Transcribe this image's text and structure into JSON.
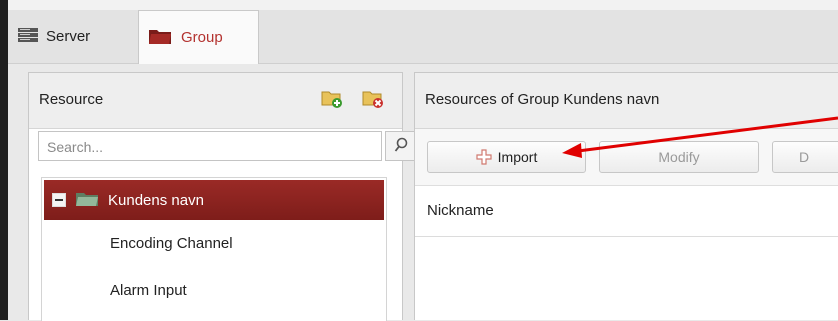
{
  "tabs": [
    {
      "label": "Server",
      "icon": "server-icon",
      "active": false
    },
    {
      "label": "Group",
      "icon": "group-folder-icon",
      "active": true
    }
  ],
  "resource_panel": {
    "title": "Resource",
    "icons": [
      "add-group-icon",
      "delete-group-icon"
    ],
    "search_placeholder": "Search...",
    "tree": {
      "root_label": "Kundens navn",
      "children": [
        "Encoding Channel",
        "Alarm Input"
      ]
    }
  },
  "group_panel": {
    "title": "Resources of Group Kundens navn",
    "buttons": {
      "import": "Import",
      "modify": "Modify",
      "delete": "D"
    },
    "columns": [
      "Nickname"
    ]
  },
  "colors": {
    "accent": "#8b2320",
    "annotation_arrow": "#e00000"
  }
}
